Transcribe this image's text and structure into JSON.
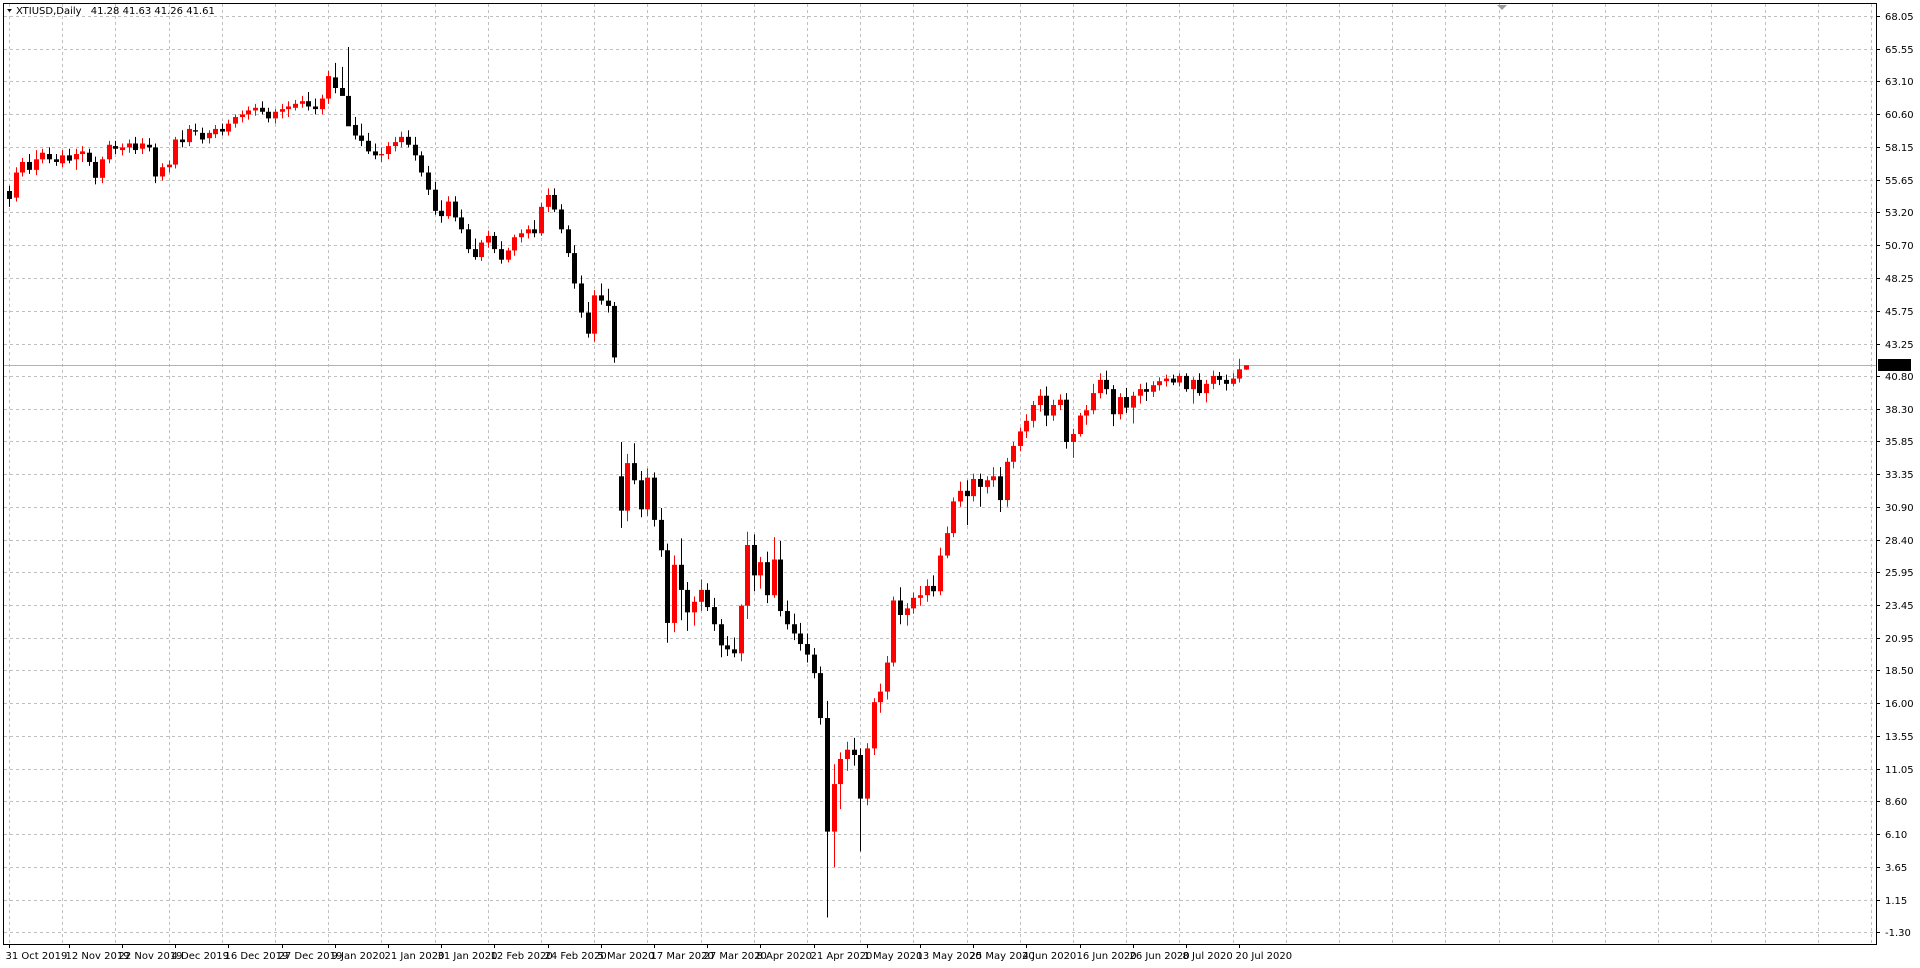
{
  "header": {
    "symbol": "XTIUSD,Daily",
    "ohlc": "41.28 41.63 41.26 41.61"
  },
  "current_price_label": "41.61",
  "colors": {
    "background": "#ffffff",
    "grid": "#c0c0c0",
    "bull": "#ff0000",
    "bear": "#000000",
    "price_line": "#a5b4cf"
  },
  "chart_data": {
    "type": "candlestick",
    "title": "",
    "grid": true,
    "y_ticks": [
      "68.05",
      "65.55",
      "63.10",
      "60.60",
      "58.15",
      "55.65",
      "53.20",
      "50.70",
      "48.25",
      "45.75",
      "43.25",
      "40.80",
      "38.30",
      "35.85",
      "33.35",
      "30.90",
      "28.40",
      "25.95",
      "23.45",
      "20.95",
      "18.50",
      "16.00",
      "13.55",
      "11.05",
      "8.60",
      "6.10",
      "3.65",
      "1.15",
      "-1.30"
    ],
    "ylim": [
      -1.3,
      68.05
    ],
    "x_ticks": [
      {
        "label": "31 Oct 2019",
        "index": 0
      },
      {
        "label": "12 Nov 2019",
        "index": 9
      },
      {
        "label": "22 Nov 2019",
        "index": 17
      },
      {
        "label": "4 Dec 2019",
        "index": 25
      },
      {
        "label": "16 Dec 2019",
        "index": 33
      },
      {
        "label": "27 Dec 2019",
        "index": 41
      },
      {
        "label": "9 Jan 2020",
        "index": 49
      },
      {
        "label": "21 Jan 2020",
        "index": 57
      },
      {
        "label": "31 Jan 2020",
        "index": 65
      },
      {
        "label": "12 Feb 2020",
        "index": 73
      },
      {
        "label": "24 Feb 2020",
        "index": 81
      },
      {
        "label": "5 Mar 2020",
        "index": 89
      },
      {
        "label": "17 Mar 2020",
        "index": 97
      },
      {
        "label": "27 Mar 2020",
        "index": 105
      },
      {
        "label": "8 Apr 2020",
        "index": 113
      },
      {
        "label": "21 Apr 2020",
        "index": 121
      },
      {
        "label": "1 May 2020",
        "index": 129
      },
      {
        "label": "13 May 2020",
        "index": 137
      },
      {
        "label": "25 May 2020",
        "index": 145
      },
      {
        "label": "4 Jun 2020",
        "index": 153
      },
      {
        "label": "16 Jun 2020",
        "index": 161
      },
      {
        "label": "26 Jun 2020",
        "index": 169
      },
      {
        "label": "8 Jul 2020",
        "index": 177
      },
      {
        "label": "20 Jul 2020",
        "index": 185
      }
    ],
    "current_price": 41.61,
    "candles_ohlc": [
      [
        54.8,
        55.2,
        53.6,
        54.2
      ],
      [
        54.3,
        56.6,
        54.0,
        56.2
      ],
      [
        56.2,
        57.3,
        55.9,
        57.0
      ],
      [
        57.0,
        57.6,
        56.1,
        56.4
      ],
      [
        56.4,
        57.9,
        56.0,
        57.2
      ],
      [
        57.2,
        58.0,
        56.9,
        57.7
      ],
      [
        57.6,
        58.1,
        56.9,
        57.2
      ],
      [
        57.2,
        57.6,
        56.7,
        57.0
      ],
      [
        56.9,
        57.9,
        56.6,
        57.5
      ],
      [
        57.5,
        58.0,
        56.9,
        57.1
      ],
      [
        57.2,
        58.0,
        56.4,
        57.6
      ],
      [
        57.6,
        58.2,
        57.0,
        57.8
      ],
      [
        57.7,
        58.0,
        56.7,
        57.0
      ],
      [
        57.0,
        57.4,
        55.3,
        55.8
      ],
      [
        55.8,
        57.4,
        55.4,
        57.2
      ],
      [
        57.2,
        58.6,
        56.9,
        58.3
      ],
      [
        58.2,
        58.6,
        57.6,
        58.0
      ],
      [
        57.9,
        58.4,
        57.5,
        58.1
      ],
      [
        58.1,
        58.7,
        57.7,
        58.4
      ],
      [
        58.4,
        58.9,
        57.6,
        57.9
      ],
      [
        58.0,
        58.8,
        57.6,
        58.4
      ],
      [
        58.3,
        58.8,
        57.8,
        58.1
      ],
      [
        58.1,
        58.4,
        55.4,
        55.9
      ],
      [
        55.9,
        56.9,
        55.6,
        56.6
      ],
      [
        56.6,
        57.1,
        56.2,
        56.8
      ],
      [
        56.8,
        58.9,
        56.5,
        58.7
      ],
      [
        58.7,
        59.4,
        58.1,
        58.5
      ],
      [
        58.5,
        59.8,
        58.2,
        59.5
      ],
      [
        59.4,
        59.9,
        59.0,
        59.3
      ],
      [
        59.2,
        59.6,
        58.4,
        58.7
      ],
      [
        58.8,
        59.4,
        58.4,
        59.2
      ],
      [
        59.1,
        59.8,
        58.8,
        59.5
      ],
      [
        59.5,
        59.9,
        59.0,
        59.3
      ],
      [
        59.3,
        60.2,
        59.0,
        59.9
      ],
      [
        59.9,
        60.6,
        59.6,
        60.4
      ],
      [
        60.4,
        60.9,
        60.0,
        60.6
      ],
      [
        60.6,
        61.2,
        60.2,
        60.9
      ],
      [
        60.9,
        61.4,
        60.5,
        61.1
      ],
      [
        61.1,
        61.6,
        60.6,
        60.8
      ],
      [
        60.8,
        61.1,
        60.0,
        60.3
      ],
      [
        60.3,
        61.0,
        59.9,
        60.8
      ],
      [
        60.8,
        61.4,
        60.3,
        61.0
      ],
      [
        61.0,
        61.6,
        60.4,
        61.2
      ],
      [
        61.1,
        61.7,
        60.9,
        61.4
      ],
      [
        61.4,
        62.0,
        61.1,
        61.6
      ],
      [
        61.6,
        62.3,
        60.9,
        61.2
      ],
      [
        61.2,
        61.8,
        60.6,
        61.0
      ],
      [
        61.0,
        62.1,
        60.6,
        61.8
      ],
      [
        61.8,
        63.9,
        61.4,
        63.5
      ],
      [
        63.4,
        64.5,
        62.2,
        62.6
      ],
      [
        62.6,
        64.2,
        62.0,
        62.0
      ],
      [
        62.0,
        65.7,
        61.0,
        59.7
      ],
      [
        59.8,
        60.4,
        58.7,
        59.0
      ],
      [
        59.0,
        59.9,
        58.2,
        58.6
      ],
      [
        58.6,
        59.2,
        57.6,
        57.8
      ],
      [
        57.8,
        58.4,
        57.2,
        57.5
      ],
      [
        57.5,
        58.1,
        57.0,
        57.6
      ],
      [
        57.6,
        58.5,
        57.2,
        58.2
      ],
      [
        58.2,
        58.9,
        57.8,
        58.5
      ],
      [
        58.5,
        59.3,
        58.1,
        58.9
      ],
      [
        58.9,
        59.4,
        58.1,
        58.3
      ],
      [
        58.3,
        58.9,
        57.1,
        57.5
      ],
      [
        57.5,
        57.8,
        55.9,
        56.2
      ],
      [
        56.2,
        56.7,
        54.5,
        54.9
      ],
      [
        54.9,
        55.5,
        53.0,
        53.3
      ],
      [
        53.3,
        54.1,
        52.4,
        52.9
      ],
      [
        52.9,
        54.4,
        52.7,
        54.0
      ],
      [
        54.0,
        54.4,
        52.5,
        52.8
      ],
      [
        52.8,
        53.4,
        51.6,
        51.9
      ],
      [
        51.9,
        52.3,
        50.1,
        50.4
      ],
      [
        50.4,
        51.2,
        49.6,
        49.8
      ],
      [
        49.8,
        51.1,
        49.5,
        50.9
      ],
      [
        50.9,
        51.8,
        50.5,
        51.4
      ],
      [
        51.4,
        51.7,
        50.1,
        50.4
      ],
      [
        50.4,
        51.0,
        49.3,
        49.6
      ],
      [
        49.6,
        50.5,
        49.4,
        50.3
      ],
      [
        50.3,
        51.5,
        49.9,
        51.3
      ],
      [
        51.3,
        51.9,
        50.9,
        51.6
      ],
      [
        51.6,
        52.2,
        51.2,
        51.9
      ],
      [
        51.9,
        52.6,
        51.3,
        51.6
      ],
      [
        51.6,
        53.9,
        51.4,
        53.6
      ],
      [
        53.6,
        55.0,
        53.2,
        54.5
      ],
      [
        54.5,
        55.0,
        53.2,
        53.4
      ],
      [
        53.4,
        53.8,
        51.6,
        51.9
      ],
      [
        51.9,
        52.2,
        49.8,
        50.1
      ],
      [
        50.1,
        50.7,
        47.4,
        47.8
      ],
      [
        47.8,
        48.4,
        45.2,
        45.6
      ],
      [
        45.6,
        46.4,
        43.7,
        44.0
      ],
      [
        44.0,
        47.3,
        43.4,
        46.9
      ],
      [
        46.9,
        47.8,
        46.2,
        46.5
      ],
      [
        46.5,
        47.4,
        45.6,
        46.1
      ],
      [
        46.1,
        46.4,
        41.8,
        42.2
      ],
      [
        33.2,
        35.8,
        29.3,
        30.6
      ],
      [
        30.6,
        34.9,
        29.8,
        34.2
      ],
      [
        34.2,
        35.7,
        32.6,
        32.9
      ],
      [
        32.9,
        33.6,
        30.1,
        30.7
      ],
      [
        30.7,
        33.8,
        30.2,
        33.1
      ],
      [
        33.1,
        33.5,
        29.4,
        29.9
      ],
      [
        29.9,
        30.8,
        27.1,
        27.6
      ],
      [
        27.6,
        28.1,
        20.6,
        22.1
      ],
      [
        22.1,
        27.2,
        21.4,
        26.5
      ],
      [
        26.5,
        28.5,
        22.3,
        24.6
      ],
      [
        24.6,
        25.2,
        21.5,
        22.9
      ],
      [
        22.9,
        24.1,
        21.9,
        23.7
      ],
      [
        23.7,
        25.4,
        23.0,
        24.6
      ],
      [
        24.6,
        25.1,
        23.0,
        23.3
      ],
      [
        23.3,
        24.0,
        21.5,
        22.0
      ],
      [
        22.0,
        22.4,
        19.5,
        20.4
      ],
      [
        20.4,
        21.1,
        19.6,
        20.1
      ],
      [
        20.1,
        21.0,
        19.5,
        19.8
      ],
      [
        19.8,
        23.5,
        19.2,
        23.4
      ],
      [
        23.4,
        29.0,
        22.4,
        28.0
      ],
      [
        28.0,
        28.8,
        24.5,
        25.7
      ],
      [
        25.7,
        27.1,
        24.7,
        26.7
      ],
      [
        26.7,
        27.5,
        23.6,
        24.2
      ],
      [
        24.2,
        28.6,
        24.0,
        26.9
      ],
      [
        26.9,
        28.3,
        22.6,
        23.0
      ],
      [
        23.0,
        23.8,
        21.6,
        22.0
      ],
      [
        22.0,
        22.8,
        20.8,
        21.3
      ],
      [
        21.3,
        22.1,
        20.0,
        20.5
      ],
      [
        20.5,
        21.3,
        19.1,
        19.7
      ],
      [
        19.7,
        20.2,
        17.9,
        18.3
      ],
      [
        18.3,
        18.8,
        14.4,
        14.9
      ],
      [
        14.9,
        16.2,
        -0.2,
        6.3
      ],
      [
        6.3,
        11.4,
        3.6,
        9.9
      ],
      [
        9.9,
        12.3,
        8.0,
        11.8
      ],
      [
        11.8,
        13.1,
        10.9,
        12.5
      ],
      [
        12.5,
        13.4,
        11.3,
        12.1
      ],
      [
        12.1,
        12.6,
        4.8,
        8.8
      ],
      [
        8.8,
        13.0,
        8.3,
        12.6
      ],
      [
        12.6,
        16.4,
        12.1,
        16.1
      ],
      [
        16.1,
        17.5,
        15.3,
        16.9
      ],
      [
        16.9,
        19.6,
        16.3,
        19.1
      ],
      [
        19.1,
        24.1,
        18.8,
        23.8
      ],
      [
        23.8,
        24.8,
        22.0,
        22.7
      ],
      [
        22.7,
        23.6,
        21.9,
        23.2
      ],
      [
        23.2,
        24.4,
        22.8,
        24.0
      ],
      [
        24.0,
        24.9,
        23.4,
        24.2
      ],
      [
        24.2,
        25.4,
        23.7,
        24.9
      ],
      [
        24.9,
        25.7,
        24.1,
        24.5
      ],
      [
        24.5,
        27.8,
        24.2,
        27.2
      ],
      [
        27.2,
        29.4,
        27.0,
        28.9
      ],
      [
        28.9,
        31.6,
        28.6,
        31.3
      ],
      [
        31.3,
        32.8,
        30.9,
        32.1
      ],
      [
        32.1,
        32.9,
        29.5,
        31.7
      ],
      [
        31.7,
        33.4,
        31.3,
        33.0
      ],
      [
        33.0,
        33.4,
        30.9,
        32.4
      ],
      [
        32.4,
        33.2,
        31.9,
        32.9
      ],
      [
        32.9,
        33.9,
        32.4,
        33.2
      ],
      [
        33.2,
        33.9,
        30.5,
        31.4
      ],
      [
        31.4,
        34.6,
        30.9,
        34.3
      ],
      [
        34.3,
        35.8,
        33.8,
        35.5
      ],
      [
        35.5,
        36.9,
        35.1,
        36.6
      ],
      [
        36.6,
        37.9,
        36.1,
        37.4
      ],
      [
        37.4,
        38.9,
        36.9,
        38.6
      ],
      [
        38.6,
        39.8,
        38.1,
        39.3
      ],
      [
        39.3,
        40.0,
        37.0,
        37.8
      ],
      [
        37.8,
        39.0,
        37.4,
        38.6
      ],
      [
        38.6,
        39.4,
        38.2,
        39.0
      ],
      [
        39.0,
        39.5,
        35.3,
        35.8
      ],
      [
        35.8,
        36.8,
        34.6,
        36.4
      ],
      [
        36.4,
        38.0,
        36.2,
        37.8
      ],
      [
        37.8,
        38.6,
        37.1,
        38.2
      ],
      [
        38.2,
        40.2,
        37.9,
        39.5
      ],
      [
        39.5,
        41.0,
        39.1,
        40.5
      ],
      [
        40.5,
        41.2,
        39.4,
        39.8
      ],
      [
        39.8,
        40.1,
        37.0,
        37.9
      ],
      [
        37.9,
        39.5,
        37.5,
        39.2
      ],
      [
        39.2,
        39.9,
        38.0,
        38.4
      ],
      [
        38.4,
        39.6,
        37.2,
        39.3
      ],
      [
        39.3,
        40.2,
        38.7,
        39.8
      ],
      [
        39.8,
        40.3,
        38.9,
        39.6
      ],
      [
        39.6,
        40.4,
        39.2,
        40.1
      ],
      [
        40.1,
        40.7,
        39.7,
        40.4
      ],
      [
        40.4,
        40.9,
        40.0,
        40.6
      ],
      [
        40.6,
        40.9,
        40.1,
        40.3
      ],
      [
        40.3,
        41.0,
        40.0,
        40.8
      ],
      [
        40.8,
        41.0,
        39.6,
        39.8
      ],
      [
        39.8,
        40.7,
        38.7,
        40.5
      ],
      [
        40.5,
        41.0,
        39.3,
        39.5
      ],
      [
        39.5,
        40.5,
        38.8,
        40.2
      ],
      [
        40.2,
        41.2,
        39.8,
        40.8
      ],
      [
        40.8,
        41.1,
        40.1,
        40.5
      ],
      [
        40.5,
        40.9,
        39.7,
        40.2
      ],
      [
        40.2,
        41.0,
        40.0,
        40.6
      ],
      [
        40.6,
        42.1,
        40.3,
        41.3
      ],
      [
        41.28,
        41.63,
        41.26,
        41.61
      ]
    ]
  }
}
